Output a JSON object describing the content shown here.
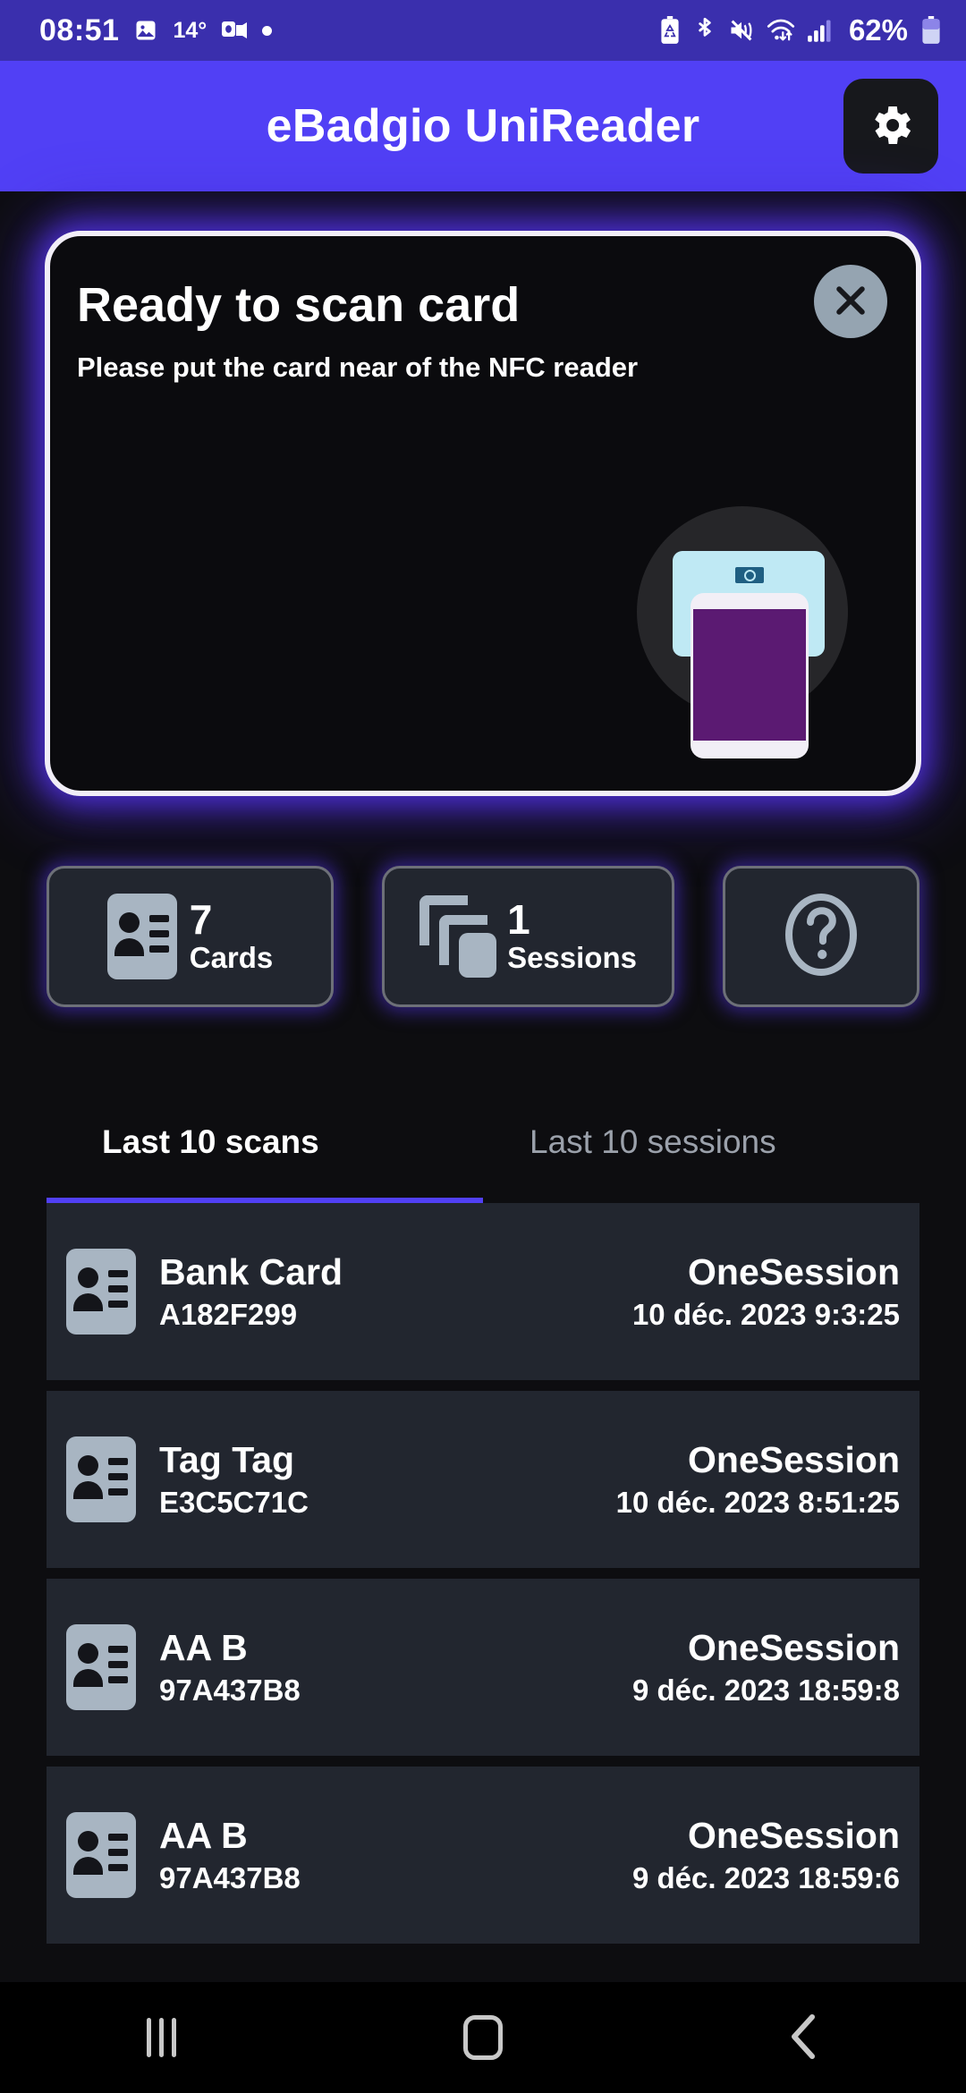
{
  "statusbar": {
    "time": "08:51",
    "temperature": "14°",
    "battery_percent": "62%",
    "icons": [
      "photo-icon",
      "outlook-icon",
      "notification-dot-icon",
      "battery-saver-icon",
      "bluetooth-icon",
      "mute-vibrate-icon",
      "wifi-icon",
      "cellular-signal-icon",
      "battery-icon"
    ]
  },
  "appbar": {
    "title": "eBadgio UniReader",
    "settings_icon": "gear-icon"
  },
  "scan_card": {
    "title": "Ready to scan card",
    "subtitle": "Please put the card near of the NFC reader",
    "close_icon": "close-icon",
    "illustration": "nfc-phone-card-illustration"
  },
  "stats": {
    "cards": {
      "count": "7",
      "label": "Cards",
      "icon": "id-card-icon"
    },
    "sessions": {
      "count": "1",
      "label": "Sessions",
      "icon": "stack-copy-icon"
    },
    "help": {
      "icon": "question-mark-icon"
    }
  },
  "tabs": [
    {
      "label": "Last 10 scans",
      "active": true
    },
    {
      "label": "Last 10 sessions",
      "active": false
    }
  ],
  "scans": [
    {
      "title": "Bank Card",
      "uid": "A182F299",
      "session": "OneSession",
      "date": "10 déc. 2023 9:3:25",
      "icon": "id-card-icon"
    },
    {
      "title": "Tag Tag",
      "uid": "E3C5C71C",
      "session": "OneSession",
      "date": "10 déc. 2023 8:51:25",
      "icon": "id-card-icon"
    },
    {
      "title": "AA B",
      "uid": "97A437B8",
      "session": "OneSession",
      "date": "9 déc. 2023 18:59:8",
      "icon": "id-card-icon"
    },
    {
      "title": "AA B",
      "uid": "97A437B8",
      "session": "OneSession",
      "date": "9 déc. 2023 18:59:6",
      "icon": "id-card-icon"
    }
  ],
  "navbar": {
    "recents_icon": "recents-icon",
    "home_icon": "home-icon",
    "back_icon": "back-chevron-icon"
  },
  "colors": {
    "statusbar_bg": "#3a2fad",
    "appbar_bg": "#5140f5",
    "page_bg": "#0d0d10",
    "card_bg": "#0b0b0e",
    "glow": "#5434e8",
    "row_bg": "#22262f",
    "icon_gray": "#a8b5c2",
    "accent": "#5140f5"
  }
}
